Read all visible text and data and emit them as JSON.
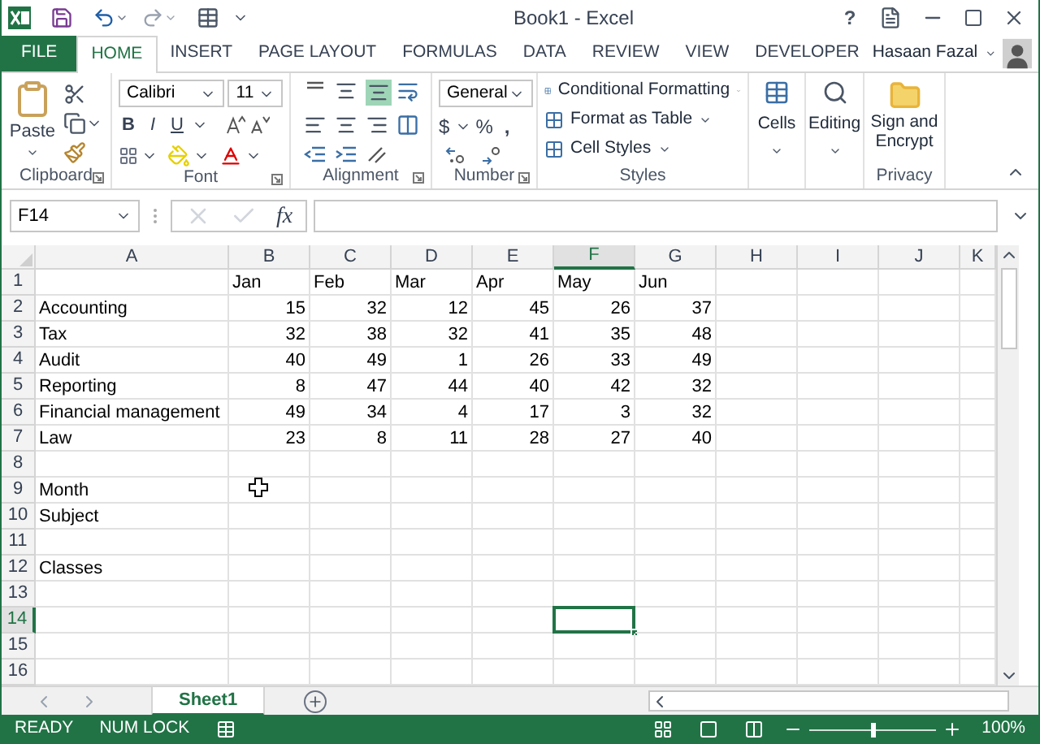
{
  "title_bar": {
    "title": "Book1 - Excel",
    "help": "?"
  },
  "tabs": [
    {
      "label": "FILE",
      "kind": "file",
      "selected": false
    },
    {
      "label": "HOME",
      "kind": "tab",
      "selected": true
    },
    {
      "label": "INSERT",
      "kind": "tab",
      "selected": false
    },
    {
      "label": "PAGE LAYOUT",
      "kind": "tab",
      "selected": false
    },
    {
      "label": "FORMULAS",
      "kind": "tab",
      "selected": false
    },
    {
      "label": "DATA",
      "kind": "tab",
      "selected": false
    },
    {
      "label": "REVIEW",
      "kind": "tab",
      "selected": false
    },
    {
      "label": "VIEW",
      "kind": "tab",
      "selected": false
    },
    {
      "label": "DEVELOPER",
      "kind": "tab",
      "selected": false
    }
  ],
  "user": {
    "name": "Hasaan Fazal"
  },
  "ribbon": {
    "clipboard": {
      "label": "Clipboard",
      "paste": "Paste"
    },
    "font": {
      "label": "Font",
      "font_name": "Calibri",
      "font_size": "11",
      "bold": "B",
      "italic": "I",
      "underline": "U"
    },
    "alignment": {
      "label": "Alignment"
    },
    "number": {
      "label": "Number",
      "format": "General",
      "currency": "$",
      "percent": "%",
      "comma": ","
    },
    "styles": {
      "label": "Styles",
      "items": [
        "Conditional Formatting",
        "Format as Table",
        "Cell Styles"
      ]
    },
    "cells": {
      "label": "Cells"
    },
    "editing": {
      "label": "Editing"
    },
    "privacy": {
      "label": "Privacy",
      "button": "Sign and Encrypt"
    }
  },
  "formula_bar": {
    "name_box": "F14",
    "function_label": "fx"
  },
  "grid": {
    "columns": [
      {
        "label": "A",
        "selected": false
      },
      {
        "label": "B",
        "selected": false
      },
      {
        "label": "C",
        "selected": false
      },
      {
        "label": "D",
        "selected": false
      },
      {
        "label": "E",
        "selected": false
      },
      {
        "label": "F",
        "selected": true
      },
      {
        "label": "G",
        "selected": false
      },
      {
        "label": "H",
        "selected": false
      },
      {
        "label": "I",
        "selected": false
      },
      {
        "label": "J",
        "selected": false
      },
      {
        "label": "K",
        "selected": false
      }
    ],
    "rows": [
      {
        "number": "1",
        "selected": false,
        "kind": "labels",
        "cells": [
          null,
          "Jan",
          "Feb",
          "Mar",
          "Apr",
          "May",
          "Jun"
        ]
      },
      {
        "number": "2",
        "selected": false,
        "kind": "values",
        "cells": [
          "Accounting",
          "15",
          "32",
          "12",
          "45",
          "26",
          "37"
        ]
      },
      {
        "number": "3",
        "selected": false,
        "kind": "values",
        "cells": [
          "Tax",
          "32",
          "38",
          "32",
          "41",
          "35",
          "48"
        ]
      },
      {
        "number": "4",
        "selected": false,
        "kind": "values",
        "cells": [
          "Audit",
          "40",
          "49",
          "1",
          "26",
          "33",
          "49"
        ]
      },
      {
        "number": "5",
        "selected": false,
        "kind": "values",
        "cells": [
          "Reporting",
          "8",
          "47",
          "44",
          "40",
          "42",
          "32"
        ]
      },
      {
        "number": "6",
        "selected": false,
        "kind": "values",
        "cells": [
          "Financial management",
          "49",
          "34",
          "4",
          "17",
          "3",
          "32"
        ]
      },
      {
        "number": "7",
        "selected": false,
        "kind": "values",
        "cells": [
          "Law",
          "23",
          "8",
          "11",
          "28",
          "27",
          "40"
        ]
      },
      {
        "number": "8",
        "selected": false
      },
      {
        "number": "9",
        "selected": false,
        "kind": "labels",
        "cells": [
          "Month"
        ]
      },
      {
        "number": "10",
        "selected": false,
        "kind": "labels",
        "cells": [
          "Subject"
        ]
      },
      {
        "number": "11",
        "selected": false
      },
      {
        "number": "12",
        "selected": false,
        "kind": "labels",
        "cells": [
          "Classes"
        ]
      },
      {
        "number": "13",
        "selected": false
      },
      {
        "number": "14",
        "selected": true
      },
      {
        "number": "15",
        "selected": false
      },
      {
        "number": "16",
        "selected": false
      }
    ]
  },
  "sheets": [
    {
      "label": "Sheet1",
      "selected": true
    }
  ],
  "status_bar": {
    "mode": "READY",
    "num_lock": "NUM LOCK",
    "zoom": "100%",
    "zoom_level": {
      "level": 0.5
    }
  }
}
